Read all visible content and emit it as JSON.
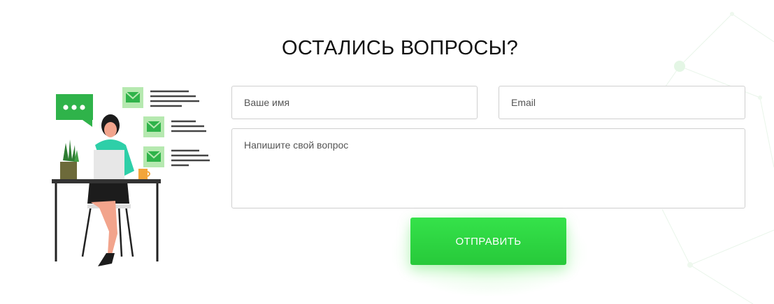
{
  "section": {
    "title": "ОСТАЛИСЬ ВОПРОСЫ?"
  },
  "form": {
    "name_placeholder": "Ваше имя",
    "email_placeholder": "Email",
    "question_placeholder": "Напишите свой вопрос",
    "submit_label": "ОТПРАВИТЬ"
  },
  "colors": {
    "accent": "#2fd843",
    "illustration_green": "#2fb34a",
    "teal": "#2ecfa8"
  },
  "icons": [
    "chat-bubble-icon",
    "envelope-icon",
    "coffee-cup-icon",
    "plant-icon"
  ]
}
